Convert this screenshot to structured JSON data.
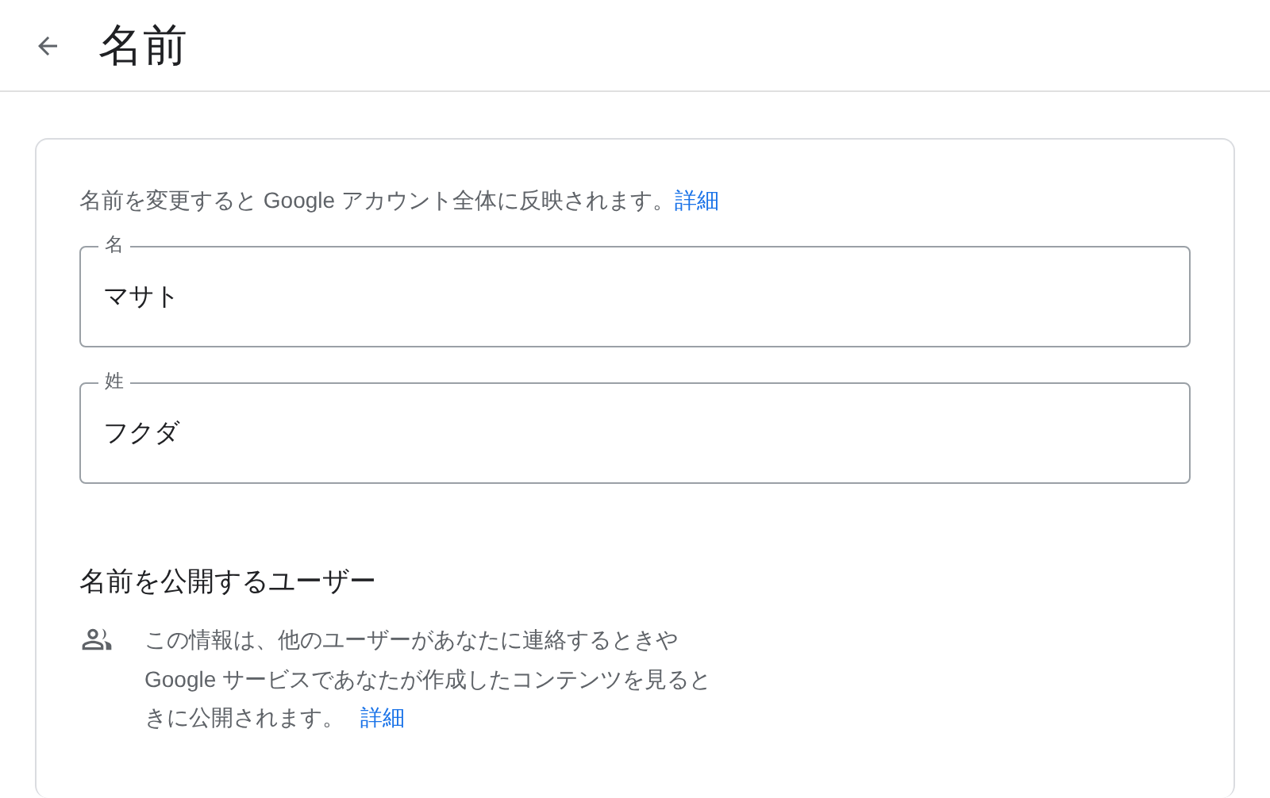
{
  "header": {
    "title": "名前"
  },
  "intro": {
    "text": "名前を変更すると Google アカウント全体に反映されます。",
    "link": "詳細"
  },
  "fields": [
    {
      "label": "名",
      "value": "マサト"
    },
    {
      "label": "姓",
      "value": "フクダ"
    }
  ],
  "visibility": {
    "title": "名前を公開するユーザー",
    "lines": [
      "この情報は、他のユーザーがあなたに連絡するときや",
      "Google サービスであなたが作成したコンテンツを見ると",
      "きに公開されます。"
    ],
    "link": "詳細"
  }
}
